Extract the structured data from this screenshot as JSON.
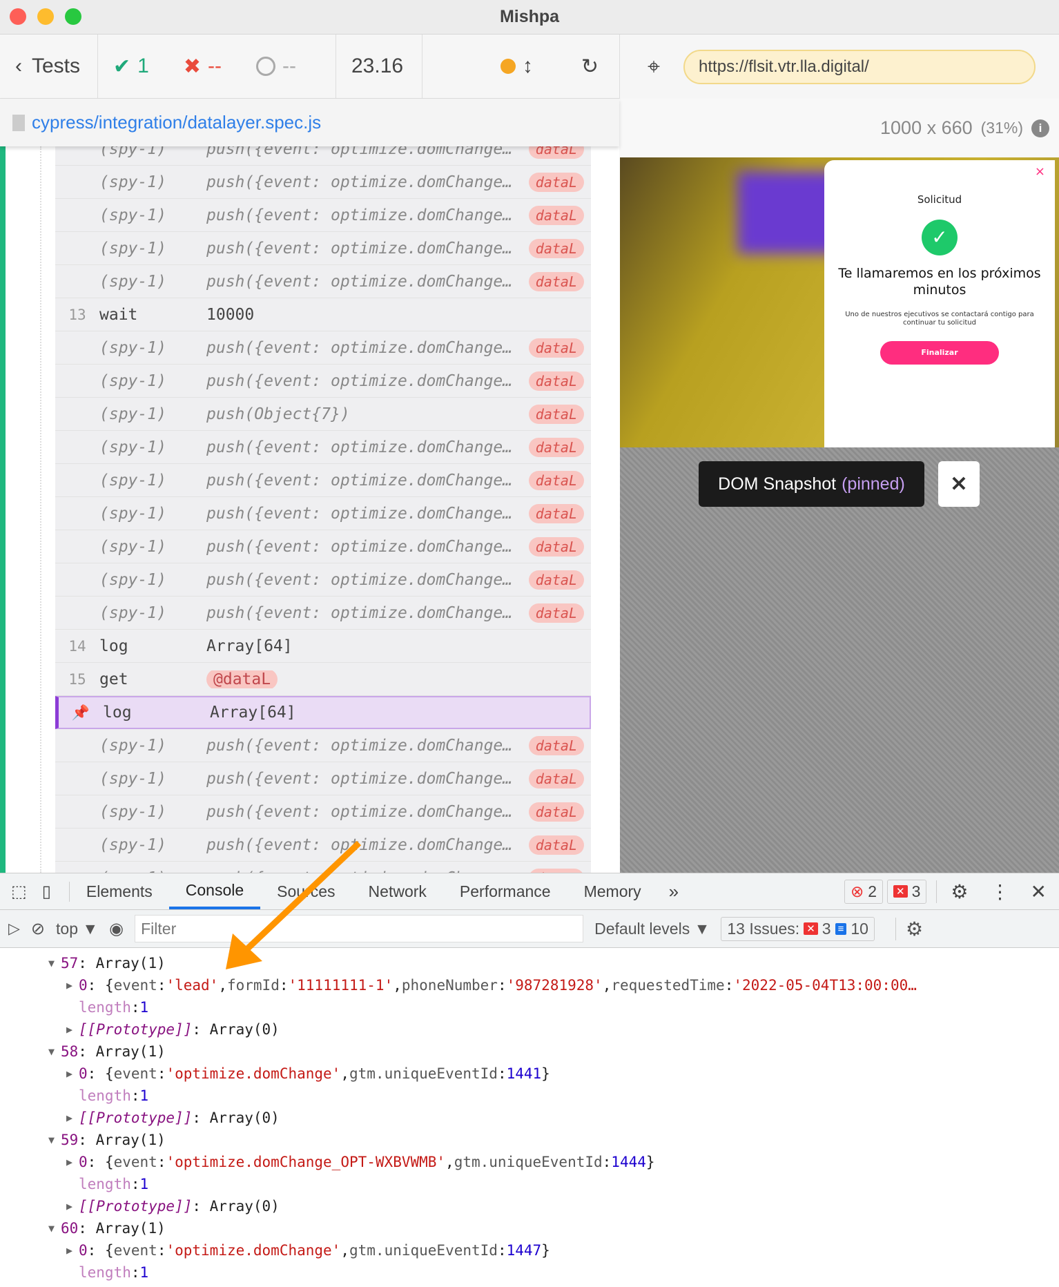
{
  "window": {
    "title": "Mishpa"
  },
  "toolbar": {
    "back_label": "Tests",
    "passed": "1",
    "failed": "--",
    "pending": "--",
    "duration": "23.16"
  },
  "spec": {
    "path": "cypress/integration/datalayer.spec.js"
  },
  "browser": {
    "url": "https://flsit.vtr.lla.digital/",
    "viewport": "1000 x 660",
    "scale": "(31%)"
  },
  "aut_modal": {
    "heading": "Solicitud",
    "title": "Te llamaremos en los próximos minutos",
    "body": "Uno de nuestros ejecutivos se contactará contigo para continuar tu solicitud",
    "button": "Finalizar",
    "close": "×"
  },
  "snapshot": {
    "label": "DOM Snapshot",
    "state": "(pinned)"
  },
  "command_log": [
    {
      "type": "spy",
      "num": "",
      "cmd": "(spy-1)",
      "msg": "push({event: optimize.domChange...",
      "alias": "dataL"
    },
    {
      "type": "spy",
      "num": "",
      "cmd": "(spy-1)",
      "msg": "push({event: optimize.domChange...",
      "alias": "dataL"
    },
    {
      "type": "spy",
      "num": "",
      "cmd": "(spy-1)",
      "msg": "push({event: optimize.domChange...",
      "alias": "dataL"
    },
    {
      "type": "spy",
      "num": "",
      "cmd": "(spy-1)",
      "msg": "push({event: optimize.domChange...",
      "alias": "dataL"
    },
    {
      "type": "spy",
      "num": "",
      "cmd": "(spy-1)",
      "msg": "push({event: optimize.domChange...",
      "alias": "dataL"
    },
    {
      "type": "cmd",
      "num": "13",
      "cmd": "wait",
      "msg": "10000",
      "alias": ""
    },
    {
      "type": "spy",
      "num": "",
      "cmd": "(spy-1)",
      "msg": "push({event: optimize.domChange...",
      "alias": "dataL"
    },
    {
      "type": "spy",
      "num": "",
      "cmd": "(spy-1)",
      "msg": "push({event: optimize.domChange...",
      "alias": "dataL"
    },
    {
      "type": "spy",
      "num": "",
      "cmd": "(spy-1)",
      "msg": "push(Object{7})",
      "alias": "dataL"
    },
    {
      "type": "spy",
      "num": "",
      "cmd": "(spy-1)",
      "msg": "push({event: optimize.domChange...",
      "alias": "dataL"
    },
    {
      "type": "spy",
      "num": "",
      "cmd": "(spy-1)",
      "msg": "push({event: optimize.domChange...",
      "alias": "dataL"
    },
    {
      "type": "spy",
      "num": "",
      "cmd": "(spy-1)",
      "msg": "push({event: optimize.domChange...",
      "alias": "dataL"
    },
    {
      "type": "spy",
      "num": "",
      "cmd": "(spy-1)",
      "msg": "push({event: optimize.domChange...",
      "alias": "dataL"
    },
    {
      "type": "spy",
      "num": "",
      "cmd": "(spy-1)",
      "msg": "push({event: optimize.domChange...",
      "alias": "dataL"
    },
    {
      "type": "spy",
      "num": "",
      "cmd": "(spy-1)",
      "msg": "push({event: optimize.domChange...",
      "alias": "dataL"
    },
    {
      "type": "cmd",
      "num": "14",
      "cmd": "log",
      "msg": "Array[64]",
      "alias": ""
    },
    {
      "type": "get",
      "num": "15",
      "cmd": "get",
      "msg": "@dataL",
      "alias": ""
    },
    {
      "type": "pinned",
      "num": "",
      "cmd": "log",
      "msg": "Array[64]",
      "alias": ""
    },
    {
      "type": "spy",
      "num": "",
      "cmd": "(spy-1)",
      "msg": "push({event: optimize.domChange...",
      "alias": "dataL"
    },
    {
      "type": "spy",
      "num": "",
      "cmd": "(spy-1)",
      "msg": "push({event: optimize.domChange...",
      "alias": "dataL"
    },
    {
      "type": "spy",
      "num": "",
      "cmd": "(spy-1)",
      "msg": "push({event: optimize.domChange...",
      "alias": "dataL"
    },
    {
      "type": "spy",
      "num": "",
      "cmd": "(spy-1)",
      "msg": "push({event: optimize.domChange...",
      "alias": "dataL"
    },
    {
      "type": "spy",
      "num": "",
      "cmd": "(spy-1)",
      "msg": "push({event: optimize.domChange...",
      "alias": "dataL"
    }
  ],
  "devtools": {
    "tabs": [
      "Elements",
      "Console",
      "Sources",
      "Network",
      "Performance",
      "Memory"
    ],
    "active_tab": "Console",
    "more": "»",
    "errors": "2",
    "warnings": "3",
    "context": "top ▼",
    "filter_placeholder": "Filter",
    "levels": "Default levels ▼",
    "issues_label": "13 Issues:",
    "issues_errors": "3",
    "issues_info": "10"
  },
  "console_lines": [
    {
      "indent": 0,
      "tri": "▼",
      "parts": [
        [
          "c-idx",
          "57"
        ],
        [
          "c-plain",
          ": Array(1)"
        ]
      ]
    },
    {
      "indent": 1,
      "tri": "▶",
      "parts": [
        [
          "c-idx",
          "0"
        ],
        [
          "c-plain",
          ": {"
        ],
        [
          "c-key",
          "event"
        ],
        [
          "c-plain",
          ": "
        ],
        [
          "c-str",
          "'lead'"
        ],
        [
          "c-plain",
          ", "
        ],
        [
          "c-key",
          "formId"
        ],
        [
          "c-plain",
          ": "
        ],
        [
          "c-str",
          "'11111111-1'"
        ],
        [
          "c-plain",
          ", "
        ],
        [
          "c-key",
          "phoneNumber"
        ],
        [
          "c-plain",
          ": "
        ],
        [
          "c-str",
          "'987281928'"
        ],
        [
          "c-plain",
          ", "
        ],
        [
          "c-key",
          "requestedTime"
        ],
        [
          "c-plain",
          ": "
        ],
        [
          "c-str",
          "'2022-05-04T13:00:00…"
        ]
      ]
    },
    {
      "indent": 1,
      "tri": "",
      "parts": [
        [
          "c-len",
          "length"
        ],
        [
          "c-plain",
          ": "
        ],
        [
          "c-num",
          "1"
        ]
      ]
    },
    {
      "indent": 1,
      "tri": "▶",
      "parts": [
        [
          "c-proto",
          "[[Prototype]]"
        ],
        [
          "c-plain",
          ": Array(0)"
        ]
      ]
    },
    {
      "indent": 0,
      "tri": "▼",
      "parts": [
        [
          "c-idx",
          "58"
        ],
        [
          "c-plain",
          ": Array(1)"
        ]
      ]
    },
    {
      "indent": 1,
      "tri": "▶",
      "parts": [
        [
          "c-idx",
          "0"
        ],
        [
          "c-plain",
          ": {"
        ],
        [
          "c-key",
          "event"
        ],
        [
          "c-plain",
          ": "
        ],
        [
          "c-str",
          "'optimize.domChange'"
        ],
        [
          "c-plain",
          ", "
        ],
        [
          "c-key",
          "gtm.uniqueEventId"
        ],
        [
          "c-plain",
          ": "
        ],
        [
          "c-num",
          "1441"
        ],
        [
          "c-plain",
          "}"
        ]
      ]
    },
    {
      "indent": 1,
      "tri": "",
      "parts": [
        [
          "c-len",
          "length"
        ],
        [
          "c-plain",
          ": "
        ],
        [
          "c-num",
          "1"
        ]
      ]
    },
    {
      "indent": 1,
      "tri": "▶",
      "parts": [
        [
          "c-proto",
          "[[Prototype]]"
        ],
        [
          "c-plain",
          ": Array(0)"
        ]
      ]
    },
    {
      "indent": 0,
      "tri": "▼",
      "parts": [
        [
          "c-idx",
          "59"
        ],
        [
          "c-plain",
          ": Array(1)"
        ]
      ]
    },
    {
      "indent": 1,
      "tri": "▶",
      "parts": [
        [
          "c-idx",
          "0"
        ],
        [
          "c-plain",
          ": {"
        ],
        [
          "c-key",
          "event"
        ],
        [
          "c-plain",
          ": "
        ],
        [
          "c-str",
          "'optimize.domChange_OPT-WXBVWMB'"
        ],
        [
          "c-plain",
          ", "
        ],
        [
          "c-key",
          "gtm.uniqueEventId"
        ],
        [
          "c-plain",
          ": "
        ],
        [
          "c-num",
          "1444"
        ],
        [
          "c-plain",
          "}"
        ]
      ]
    },
    {
      "indent": 1,
      "tri": "",
      "parts": [
        [
          "c-len",
          "length"
        ],
        [
          "c-plain",
          ": "
        ],
        [
          "c-num",
          "1"
        ]
      ]
    },
    {
      "indent": 1,
      "tri": "▶",
      "parts": [
        [
          "c-proto",
          "[[Prototype]]"
        ],
        [
          "c-plain",
          ": Array(0)"
        ]
      ]
    },
    {
      "indent": 0,
      "tri": "▼",
      "parts": [
        [
          "c-idx",
          "60"
        ],
        [
          "c-plain",
          ": Array(1)"
        ]
      ]
    },
    {
      "indent": 1,
      "tri": "▶",
      "parts": [
        [
          "c-idx",
          "0"
        ],
        [
          "c-plain",
          ": {"
        ],
        [
          "c-key",
          "event"
        ],
        [
          "c-plain",
          ": "
        ],
        [
          "c-str",
          "'optimize.domChange'"
        ],
        [
          "c-plain",
          ", "
        ],
        [
          "c-key",
          "gtm.uniqueEventId"
        ],
        [
          "c-plain",
          ": "
        ],
        [
          "c-num",
          "1447"
        ],
        [
          "c-plain",
          "}"
        ]
      ]
    },
    {
      "indent": 1,
      "tri": "",
      "parts": [
        [
          "c-len",
          "length"
        ],
        [
          "c-plain",
          ": "
        ],
        [
          "c-num",
          "1"
        ]
      ]
    }
  ],
  "colors": {
    "pass": "#1fa97a",
    "fail": "#e94b3c",
    "link": "#2f7fe8",
    "alias_bg": "#f9c6c2",
    "pinned": "#8c3cd6",
    "cta": "#ff2d7f",
    "annotation_arrow": "#ff9500"
  },
  "annotation": {
    "type": "arrow",
    "color": "#ff9500"
  }
}
